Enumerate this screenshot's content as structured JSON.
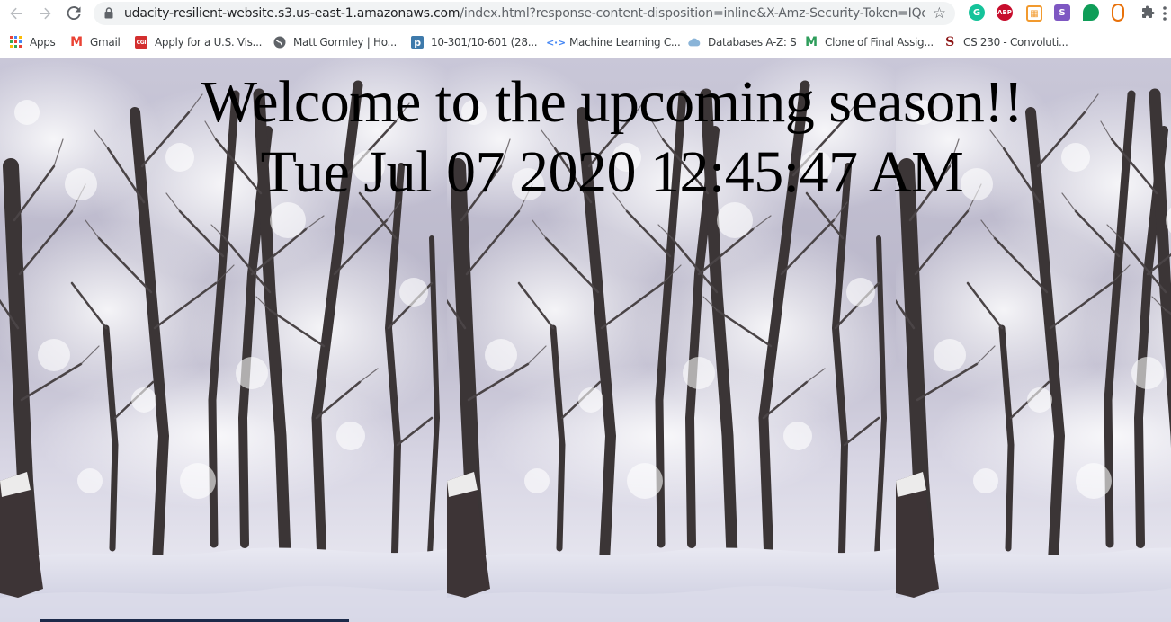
{
  "browser": {
    "url_host": "udacity-resilient-website.s3.us-east-1.amazonaws.com",
    "url_path": "/index.html?response-content-disposition=inline&X-Amz-Security-Token=IQoJb3JpZ2l...",
    "extensions": [
      {
        "name": "grammarly",
        "label": "G",
        "color": "#15c39a"
      },
      {
        "name": "adblock-plus",
        "label": "ABP",
        "color": "#c70d2c"
      },
      {
        "name": "extension-orange",
        "label": "▦",
        "color": "#f29a2e"
      },
      {
        "name": "extension-s",
        "label": "S",
        "color": "#7e57c2"
      },
      {
        "name": "extension-green-leaf",
        "label": "",
        "color": "#0f9d58"
      },
      {
        "name": "extension-capsule",
        "label": "",
        "color": "#e8710a"
      },
      {
        "name": "extensions-puzzle",
        "label": "",
        "color": "#5f6368"
      }
    ]
  },
  "bookmarks": [
    {
      "label": "Apps",
      "icon": "apps-grid-icon"
    },
    {
      "label": "Gmail",
      "icon": "gmail-icon"
    },
    {
      "label": "Apply for a U.S. Vis...",
      "icon": "cgi-icon"
    },
    {
      "label": "Matt Gormley | Ho...",
      "icon": "globe-icon"
    },
    {
      "label": "10-301/10-601 (28...",
      "icon": "piazza-icon"
    },
    {
      "label": "Machine Learning C...",
      "icon": "code-icon"
    },
    {
      "label": "Databases A-Z: S",
      "icon": "cloud-icon"
    },
    {
      "label": "Clone of Final Assig...",
      "icon": "m-icon"
    },
    {
      "label": "CS 230 - Convoluti...",
      "icon": "stanford-icon"
    }
  ],
  "page": {
    "heading": "Welcome to the upcoming season!!",
    "datetime": "Tue Jul 07 2020 12:45:47 AM",
    "background": "snowy-forest-image"
  },
  "colors": {
    "chrome_bg": "#ffffff",
    "omnibox_bg": "#f1f3f4",
    "text": "#000000"
  }
}
